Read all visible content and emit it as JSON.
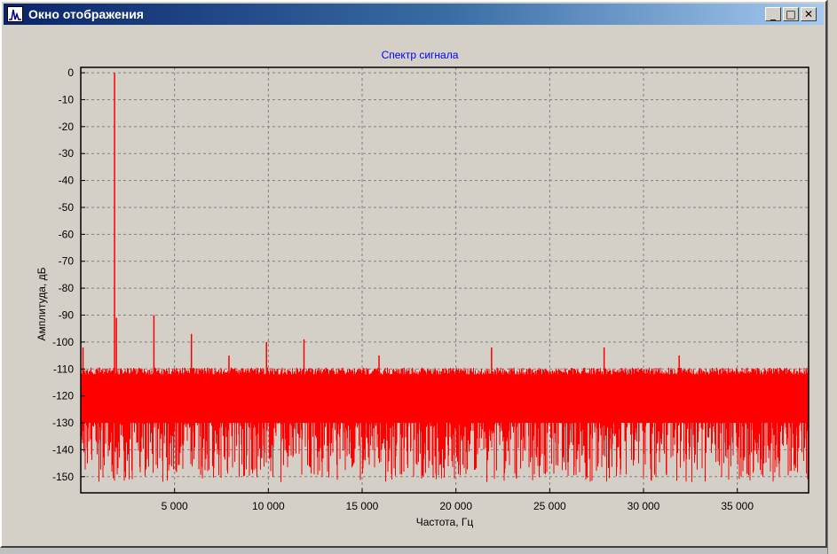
{
  "window": {
    "title": "Окно отображения",
    "icon": "spectrum-icon",
    "buttons": {
      "minimize": "_",
      "maximize": "□",
      "close": "✕"
    }
  },
  "chart_data": {
    "type": "line",
    "title": "Спектр сигнала",
    "xlabel": "Частота, Гц",
    "ylabel": "Амплитуда, дБ",
    "xlim": [
      0,
      38800
    ],
    "ylim": [
      -156,
      2
    ],
    "grid": true,
    "x_ticks": [
      5000,
      10000,
      15000,
      20000,
      25000,
      30000,
      35000
    ],
    "x_tick_labels": [
      "5 000",
      "10 000",
      "15 000",
      "20 000",
      "25 000",
      "30 000",
      "35 000"
    ],
    "y_ticks": [
      0,
      -10,
      -20,
      -30,
      -40,
      -50,
      -60,
      -70,
      -80,
      -90,
      -100,
      -110,
      -120,
      -130,
      -140,
      -150
    ],
    "y_tick_labels": [
      "0",
      "-10",
      "-20",
      "-30",
      "-40",
      "-50",
      "-60",
      "-70",
      "-80",
      "-90",
      "-100",
      "-110",
      "-120",
      "-130",
      "-140",
      "-150"
    ],
    "series": [
      {
        "color": "#ff0000",
        "noise_floor_db": [
          -152,
          -110
        ],
        "peaks": [
          {
            "x": 120,
            "y": -102
          },
          {
            "x": 1800,
            "y": 0
          },
          {
            "x": 1900,
            "y": -91
          },
          {
            "x": 3900,
            "y": -90
          },
          {
            "x": 5900,
            "y": -97
          },
          {
            "x": 7900,
            "y": -105
          },
          {
            "x": 9900,
            "y": -100
          },
          {
            "x": 11900,
            "y": -99
          },
          {
            "x": 15900,
            "y": -105
          },
          {
            "x": 21900,
            "y": -102
          },
          {
            "x": 27900,
            "y": -102
          },
          {
            "x": 31900,
            "y": -105
          }
        ]
      }
    ]
  }
}
